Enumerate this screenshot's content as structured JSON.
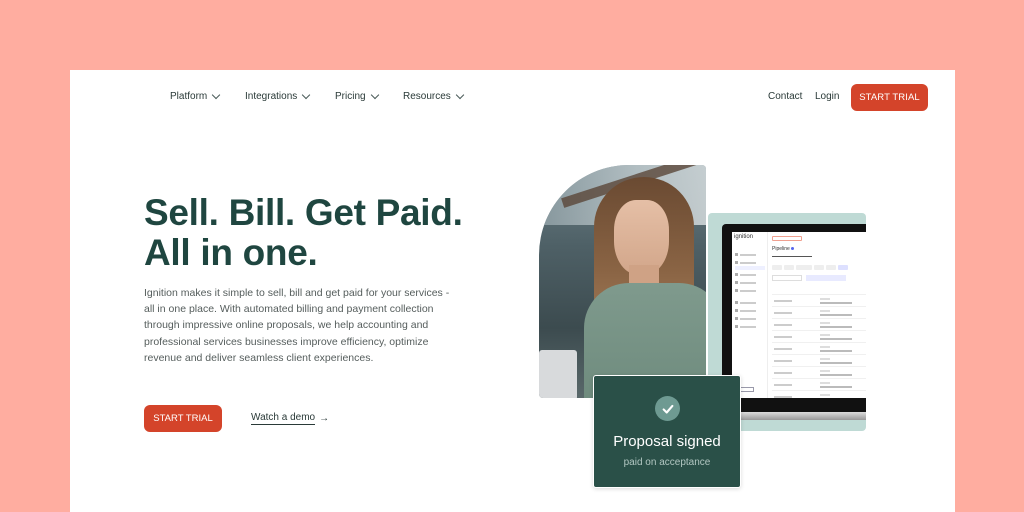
{
  "nav": {
    "items": [
      {
        "label": "Platform",
        "icon": "chevron-down-icon"
      },
      {
        "label": "Integrations",
        "icon": "chevron-down-icon"
      },
      {
        "label": "Pricing",
        "icon": "chevron-down-icon"
      },
      {
        "label": "Resources",
        "icon": "chevron-down-icon"
      }
    ],
    "contact": "Contact",
    "login": "Login",
    "cta": "START TRIAL"
  },
  "hero": {
    "title_line1": "Sell. Bill. Get Paid.",
    "title_line2": "All in one.",
    "description": "Ignition makes it simple to sell, bill and get paid for your services - all in one place. With automated billing and payment collection through impressive online proposals, we help accounting and professional services businesses improve efficiency, optimize revenue and deliver seamless client experiences.",
    "cta": "START TRIAL",
    "secondary_cta": "Watch a demo",
    "secondary_icon": "arrow-right-icon"
  },
  "app_preview": {
    "logo": "ignition",
    "page_title": "Pipeline"
  },
  "proposal_card": {
    "icon": "check-icon",
    "title": "Proposal signed",
    "subtitle": "paid on acceptance"
  },
  "colors": {
    "background": "#ffada0",
    "accent": "#d4442a",
    "heading": "#1f4640",
    "card": "#2a5048",
    "preview_bg": "#bfdad5"
  }
}
